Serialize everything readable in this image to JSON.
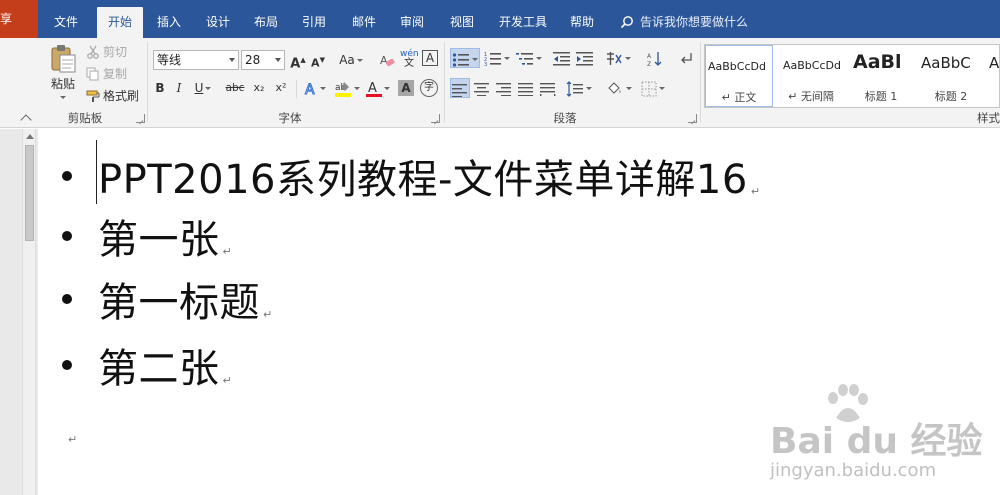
{
  "titlebar": {
    "share_label": "共享"
  },
  "tabs": [
    {
      "label": "文件",
      "active": false
    },
    {
      "label": "开始",
      "active": true
    },
    {
      "label": "插入",
      "active": false
    },
    {
      "label": "设计",
      "active": false
    },
    {
      "label": "布局",
      "active": false
    },
    {
      "label": "引用",
      "active": false
    },
    {
      "label": "邮件",
      "active": false
    },
    {
      "label": "审阅",
      "active": false
    },
    {
      "label": "视图",
      "active": false
    },
    {
      "label": "开发工具",
      "active": false
    },
    {
      "label": "帮助",
      "active": false
    }
  ],
  "tell_me": {
    "placeholder": "告诉我你想要做什么"
  },
  "clipboard": {
    "group_label": "剪贴板",
    "paste_label": "粘贴",
    "cut_label": "剪切",
    "copy_label": "复制",
    "format_painter_label": "格式刷"
  },
  "font": {
    "group_label": "字体",
    "font_name": "等线",
    "font_size": "28",
    "grow_label": "A",
    "shrink_label": "A",
    "case_label": "Aa",
    "bold_label": "B",
    "italic_label": "I",
    "underline_label": "U",
    "strike_label": "abc",
    "subscript_label": "x₂",
    "superscript_label": "x²",
    "phonetic_label": "wén",
    "border_char_label": "A",
    "enclose_label": "字",
    "font_color": "#e81123",
    "highlight_color": "#fff200"
  },
  "paragraph": {
    "group_label": "段落"
  },
  "styles": {
    "group_label": "样式",
    "items": [
      {
        "sample": "AaBbCcDd",
        "name": "↵ 正文"
      },
      {
        "sample": "AaBbCcDd",
        "name": "↵ 无间隔"
      },
      {
        "sample": "AaBl",
        "name": "标题 1"
      },
      {
        "sample": "AaBbC",
        "name": "标题 2"
      },
      {
        "sample": "A",
        "name": ""
      }
    ]
  },
  "document": {
    "bullets": [
      "PPT2016系列教程-文件菜单详解16",
      "第一张",
      "第一标题",
      "第二张"
    ],
    "para_mark": "↵"
  },
  "watermark": {
    "brand": "Bai du 经验",
    "url": "jingyan.baidu.com"
  },
  "colors": {
    "ribbon_blue": "#2b579a",
    "share_red": "#c43e1c",
    "ribbon_bg": "#f3f3f3"
  }
}
